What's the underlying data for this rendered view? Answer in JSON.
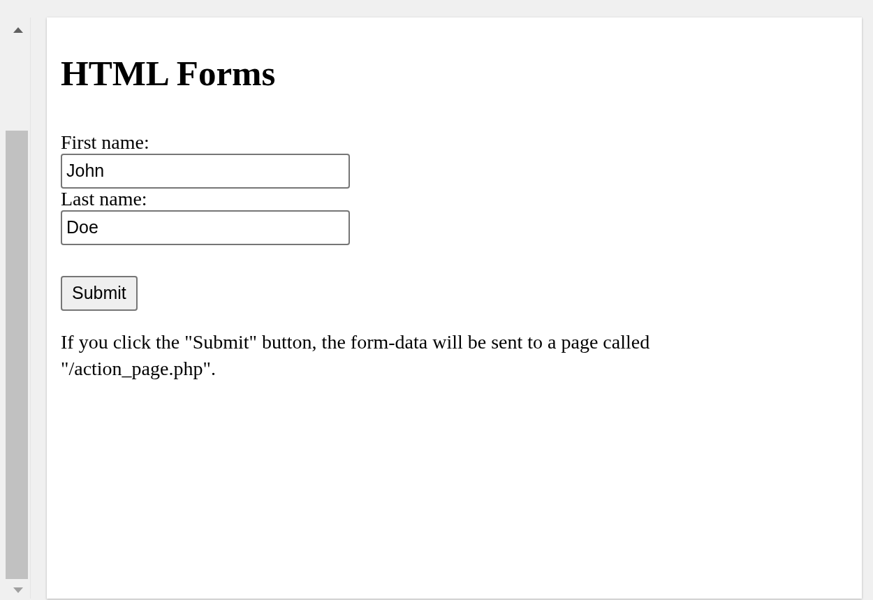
{
  "heading": "HTML Forms",
  "fields": [
    {
      "label": "First name:",
      "value": "John"
    },
    {
      "label": "Last name:",
      "value": "Doe"
    }
  ],
  "button": "Submit",
  "paragraph": "If you click the \"Submit\" button, the form-data will be sent to a page called \"/action_page.php\"."
}
